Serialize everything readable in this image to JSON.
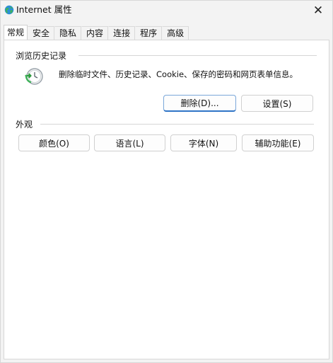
{
  "window": {
    "title": "Internet 属性",
    "close_symbol": "✕"
  },
  "tabs": [
    {
      "label": "常规",
      "active": true
    },
    {
      "label": "安全",
      "active": false
    },
    {
      "label": "隐私",
      "active": false
    },
    {
      "label": "内容",
      "active": false
    },
    {
      "label": "连接",
      "active": false
    },
    {
      "label": "程序",
      "active": false
    },
    {
      "label": "高级",
      "active": false
    }
  ],
  "browsing_history": {
    "group_label": "浏览历史记录",
    "description": "删除临时文件、历史记录、Cookie、保存的密码和网页表单信息。",
    "delete_button": "删除(D)...",
    "settings_button": "设置(S)"
  },
  "appearance": {
    "group_label": "外观",
    "colors_button": "颜色(O)",
    "languages_button": "语言(L)",
    "fonts_button": "字体(N)",
    "accessibility_button": "辅助功能(E)"
  },
  "icons": {
    "app": "internet-globe-icon",
    "history": "clock-refresh-icon",
    "close": "close-icon"
  },
  "colors": {
    "primary_button_border": "#2f74c6",
    "window_bg": "#f3f3f3",
    "panel_bg": "#ffffff"
  }
}
